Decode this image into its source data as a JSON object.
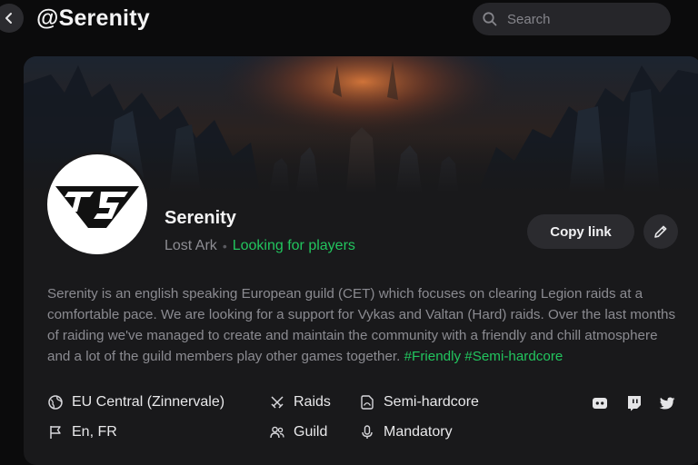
{
  "header": {
    "title": "@Serenity",
    "search_placeholder": "Search"
  },
  "guild": {
    "name": "Serenity",
    "game": "Lost Ark",
    "status": "Looking for players",
    "status_color": "#22c55e",
    "description": "Serenity is an english speaking European guild (CET) which focuses on clearing Legion raids at a comfortable pace. We are looking for a support for Vykas and Valtan (Hard) raids. Over the last months of raiding we've managed to create and maintain the community with a friendly and chill atmosphere and a lot of the guild members play other games together.",
    "tags": "#Friendly #Semi-hardcore"
  },
  "actions": {
    "copy_link": "Copy link"
  },
  "details": {
    "region": "EU Central (Zinnervale)",
    "activity": "Raids",
    "intensity": "Semi-hardcore",
    "languages": "En, FR",
    "type": "Guild",
    "voice": "Mandatory"
  },
  "social_links": [
    "discord-icon",
    "twitch-icon",
    "twitter-icon"
  ]
}
